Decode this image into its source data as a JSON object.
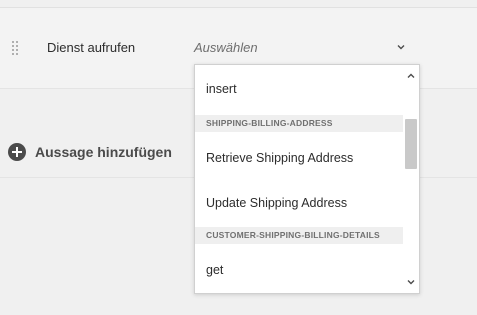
{
  "service_row": {
    "label": "Dienst aufrufen",
    "select_placeholder": "Auswählen"
  },
  "add_statement": {
    "label": "Aussage hinzufügen"
  },
  "dropdown": {
    "items": {
      "insert": "insert",
      "group_shipping_billing_address": "SHIPPING-BILLING-ADDRESS",
      "retrieve_shipping_address": "Retrieve Shipping Address",
      "update_shipping_address": "Update Shipping Address",
      "group_customer_shipping_billing_details": "CUSTOMER-SHIPPING-BILLING-DETAILS",
      "get": "get"
    }
  },
  "icons": {
    "drag": "drag-handle-icon",
    "chevron": "chevron-down-icon",
    "add": "add-circle-icon",
    "scroll_up": "chevron-up-icon",
    "scroll_down": "chevron-down-icon"
  },
  "colors": {
    "background": "#f0f0f0",
    "popover_bg": "#ffffff",
    "group_header_bg": "#efefef",
    "add_icon": "#4b4b4b"
  }
}
